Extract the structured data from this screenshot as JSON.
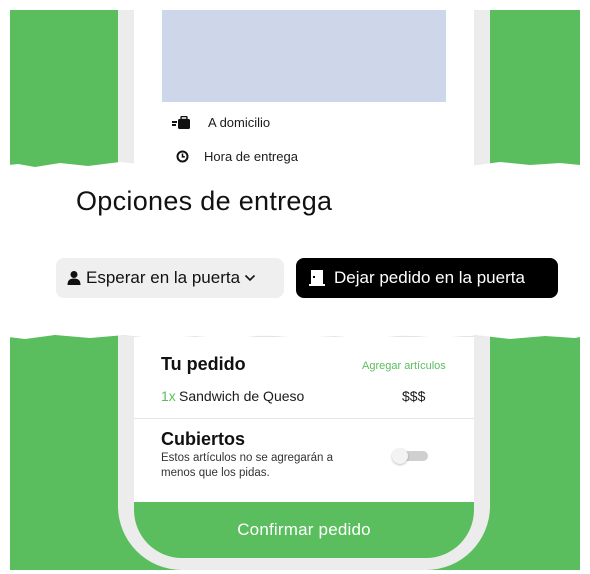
{
  "colors": {
    "brand_green": "#5BBE5E",
    "map_placeholder": "#ced6ea",
    "black_pill": "#000000",
    "light_pill": "#efefef"
  },
  "delivery_rows": [
    {
      "icon": "delivery-bag-icon",
      "label": "A domicilio"
    },
    {
      "icon": "clock-icon",
      "label": "Hora de entrega"
    }
  ],
  "options_panel": {
    "title": "Opciones de entrega",
    "option_wait": {
      "icon": "person-icon",
      "label": "Esperar en la puerta",
      "dropdown_icon": "chevron-down-icon"
    },
    "option_leave": {
      "icon": "door-icon",
      "label": "Dejar pedido en la puerta",
      "selected": true
    }
  },
  "order": {
    "title": "Tu pedido",
    "add_items": "Agregar artículos",
    "items": [
      {
        "qty": "1x",
        "name": "Sandwich de Queso",
        "price": "$$$"
      }
    ]
  },
  "cutlery": {
    "title": "Cubiertos",
    "description": "Estos artículos no se agregarán a menos que los pidas.",
    "enabled": false
  },
  "confirm_button": "Confirmar pedido"
}
